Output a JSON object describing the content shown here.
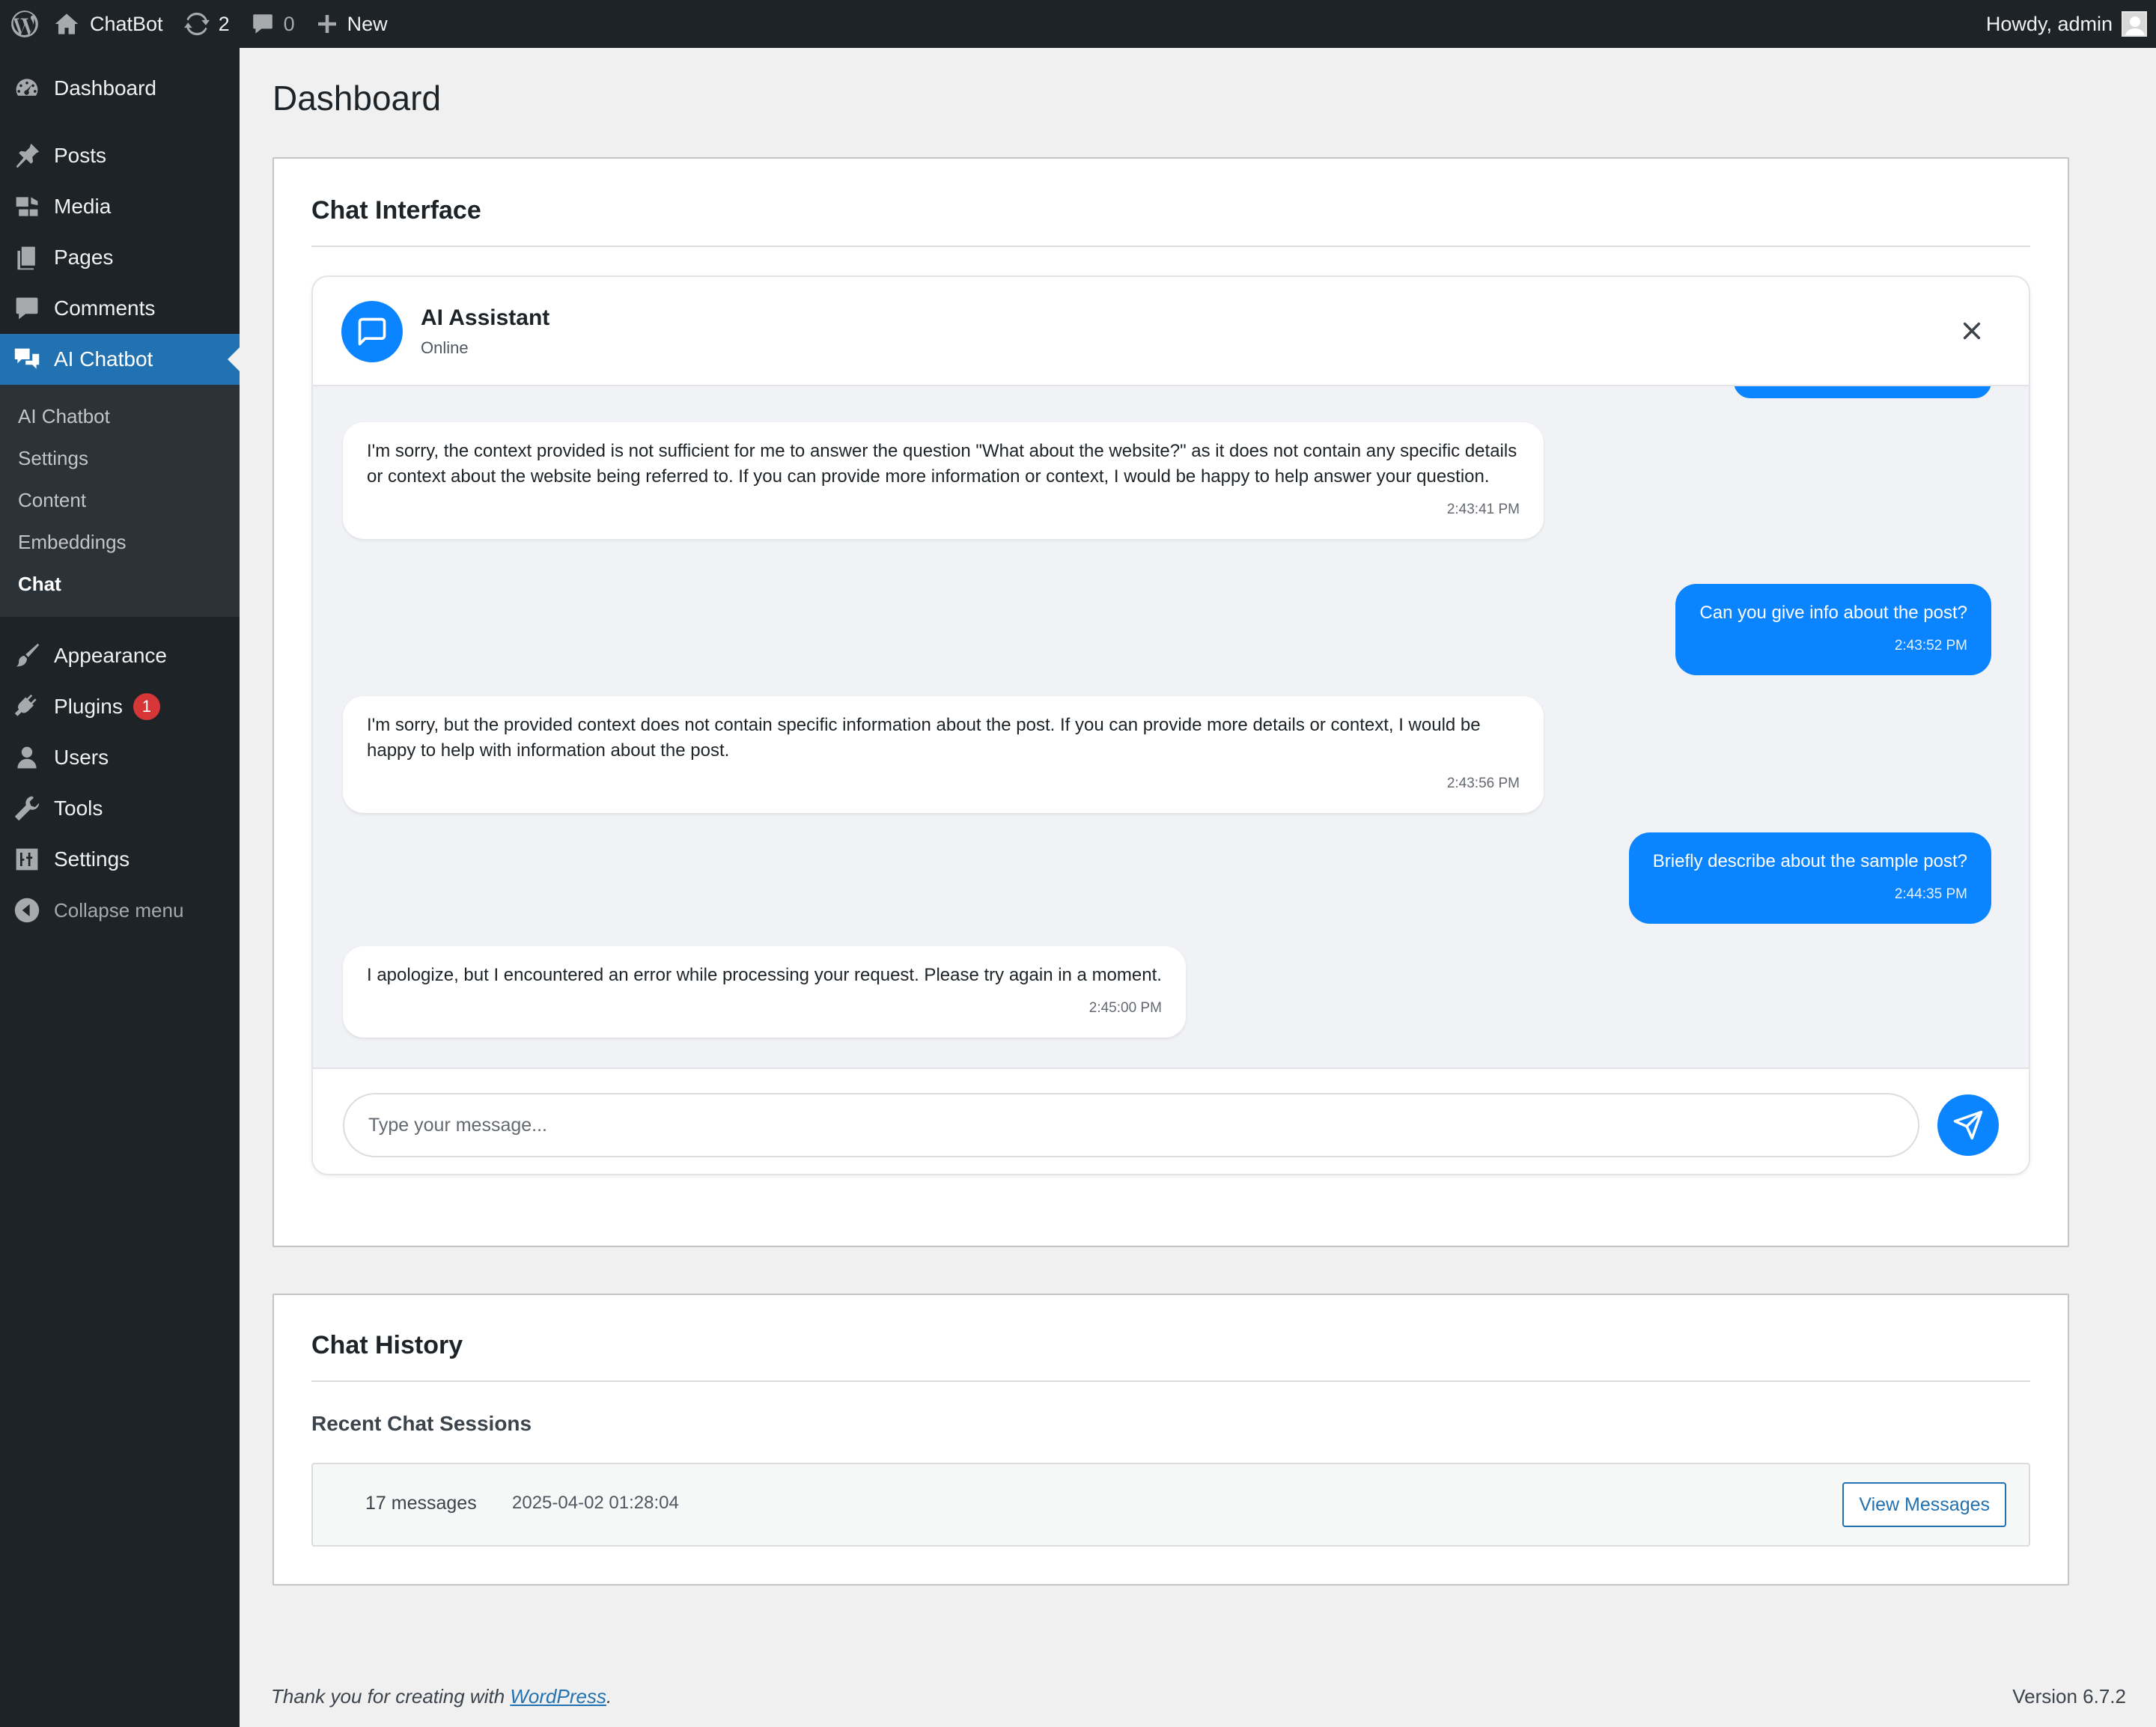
{
  "admin_bar": {
    "site_name": "ChatBot",
    "updates_count": "2",
    "comments_count": "0",
    "new_label": "New",
    "greeting": "Howdy, admin"
  },
  "sidebar": {
    "items": [
      {
        "label": "Dashboard",
        "icon": "dashboard-icon"
      },
      {
        "label": "Posts",
        "icon": "pin-icon"
      },
      {
        "label": "Media",
        "icon": "media-icon"
      },
      {
        "label": "Pages",
        "icon": "pages-icon"
      },
      {
        "label": "Comments",
        "icon": "comment-icon"
      },
      {
        "label": "AI Chatbot",
        "icon": "chat-bubbles-icon"
      }
    ],
    "submenu": [
      "AI Chatbot",
      "Settings",
      "Content",
      "Embeddings",
      "Chat"
    ],
    "items2": [
      {
        "label": "Appearance",
        "icon": "brush-icon"
      },
      {
        "label": "Plugins",
        "icon": "plug-icon",
        "badge": "1"
      },
      {
        "label": "Users",
        "icon": "user-icon"
      },
      {
        "label": "Tools",
        "icon": "wrench-icon"
      },
      {
        "label": "Settings",
        "icon": "sliders-icon"
      }
    ],
    "collapse_label": "Collapse menu"
  },
  "page": {
    "title": "Dashboard"
  },
  "chat_card": {
    "title": "Chat Interface",
    "assistant_name": "AI Assistant",
    "assistant_status": "Online",
    "messages": [
      {
        "role": "bot",
        "text": "I'm sorry, the context provided is not sufficient for me to answer the question \"What about the website?\" as it does not contain any specific details or context about the website being referred to. If you can provide more information or context, I would be happy to help answer your question.",
        "time": "2:43:41 PM"
      },
      {
        "role": "user",
        "text": "Can you give info about the post?",
        "time": "2:43:52 PM"
      },
      {
        "role": "bot",
        "text": "I'm sorry, but the provided context does not contain specific information about the post. If you can provide more details or context, I would be happy to help with information about the post.",
        "time": "2:43:56 PM"
      },
      {
        "role": "user",
        "text": "Briefly describe about the sample post?",
        "time": "2:44:35 PM"
      },
      {
        "role": "bot",
        "text": "I apologize, but I encountered an error while processing your request. Please try again in a moment.",
        "time": "2:45:00 PM"
      }
    ],
    "input_placeholder": "Type your message...",
    "input_value": ""
  },
  "history_card": {
    "title": "Chat History",
    "subtitle": "Recent Chat Sessions",
    "sessions": [
      {
        "count": "17 messages",
        "date": "2025-04-02 01:28:04",
        "button": "View Messages"
      }
    ]
  },
  "footer": {
    "thanks_prefix": "Thank you for creating with ",
    "thanks_link": "WordPress",
    "thanks_suffix": ".",
    "version": "Version 6.7.2"
  },
  "colors": {
    "admin_dark": "#1d2327",
    "wp_blue": "#2271b1",
    "chat_blue": "#0a84ff",
    "badge_red": "#d63638"
  }
}
